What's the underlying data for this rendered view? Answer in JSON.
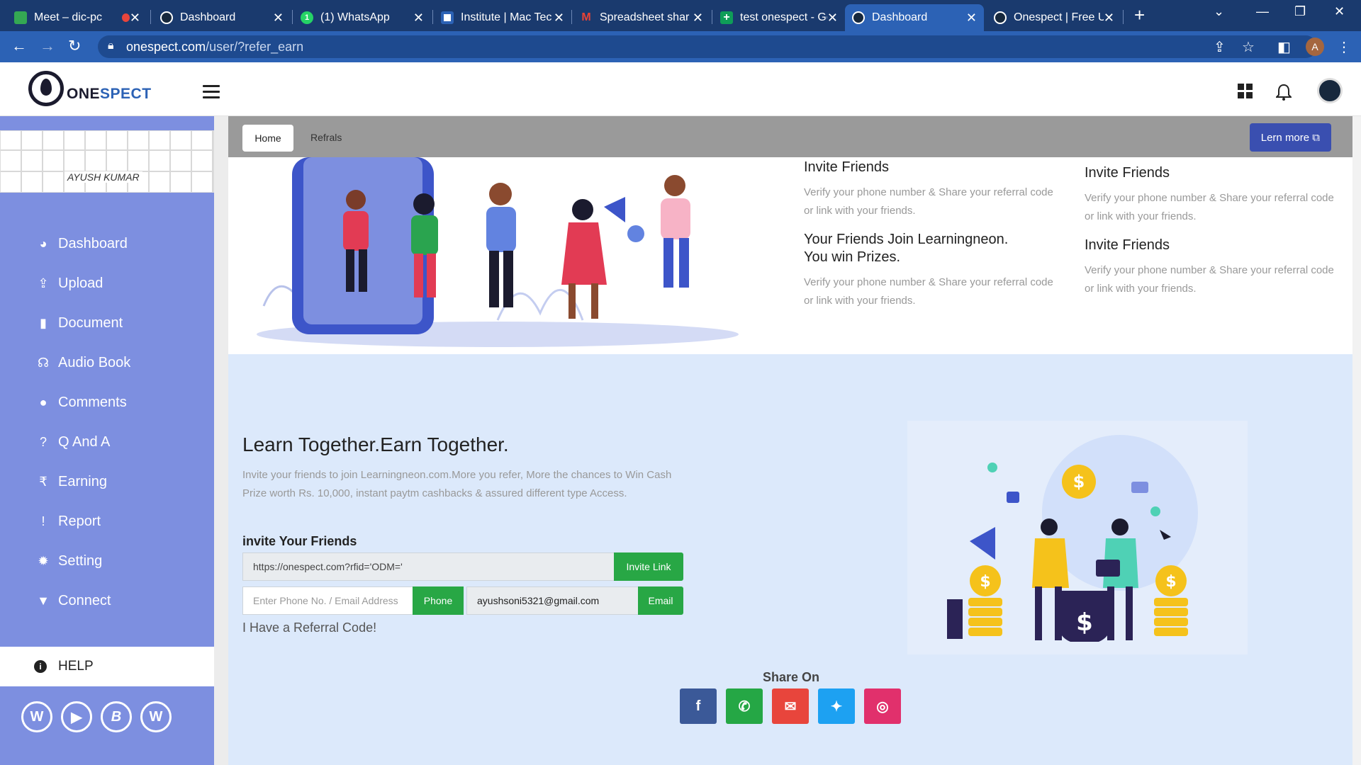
{
  "browser": {
    "tabs": [
      {
        "title": "Meet – dic-pc",
        "fav_color": "#34a853",
        "fav_char": "",
        "active": false
      },
      {
        "title": "Dashboard",
        "fav_color": "#17283d",
        "fav_char": "",
        "active": false
      },
      {
        "title": "(1) WhatsApp",
        "fav_color": "#25d366",
        "fav_char": "1",
        "active": false
      },
      {
        "title": "Institute | Mac Tec",
        "fav_color": "#ffffff",
        "fav_char": "",
        "active": false
      },
      {
        "title": "Spreadsheet shar",
        "fav_color": "#ea4335",
        "fav_char": "M",
        "active": false
      },
      {
        "title": "test onespect - Go",
        "fav_color": "#0f9d58",
        "fav_char": "+",
        "active": false
      },
      {
        "title": "Dashboard",
        "fav_color": "#17283d",
        "fav_char": "",
        "active": true
      },
      {
        "title": "Onespect | Free U",
        "fav_color": "#17283d",
        "fav_char": "",
        "active": false
      }
    ],
    "url_host": "onespect.com",
    "url_path": "/user/?refer_earn",
    "profile_initial": "A"
  },
  "header": {
    "logo_part1": "ONE",
    "logo_part2": "SPECT"
  },
  "sidebar": {
    "user_name": "AYUSH KUMAR",
    "items": [
      {
        "label": "Dashboard",
        "icon": "dashboard-icon",
        "glyph": "◕"
      },
      {
        "label": "Upload",
        "icon": "upload-icon",
        "glyph": "⇪"
      },
      {
        "label": "Document",
        "icon": "document-icon",
        "glyph": "▮"
      },
      {
        "label": "Audio Book",
        "icon": "headphones-icon",
        "glyph": "☊"
      },
      {
        "label": "Comments",
        "icon": "comment-icon",
        "glyph": "●"
      },
      {
        "label": "Q And A",
        "icon": "question-icon",
        "glyph": "?"
      },
      {
        "label": "Earning",
        "icon": "rupee-icon",
        "glyph": "₹"
      },
      {
        "label": "Report",
        "icon": "alert-icon",
        "glyph": "!"
      },
      {
        "label": "Setting",
        "icon": "gear-icon",
        "glyph": "✹"
      },
      {
        "label": "Connect",
        "icon": "filter-icon",
        "glyph": "▼"
      }
    ],
    "help_label": "HELP",
    "social": [
      {
        "name": "wordpress-icon",
        "glyph": "W"
      },
      {
        "name": "youtube-icon",
        "glyph": "▶"
      },
      {
        "name": "blogger-icon",
        "glyph": "B"
      },
      {
        "name": "wordpress-icon",
        "glyph": "W"
      }
    ]
  },
  "topnav": {
    "home": "Home",
    "refrals": "Refrals",
    "lern_more": "Lern more ⧉"
  },
  "info": [
    {
      "title": "Invite Friends",
      "desc": "Verify your phone number & Share your referral code or link with your friends."
    },
    {
      "title": "Your Friends Join Learningneon. You win Prizes.",
      "desc": "Verify your phone number & Share your referral code or link with your friends."
    },
    {
      "title": "Invite Friends",
      "desc": "Verify your phone number & Share your referral code or link with your friends."
    },
    {
      "title": "Invite Friends",
      "desc": "Verify your phone number & Share your referral code or link with your friends."
    }
  ],
  "earn": {
    "title": "Learn Together.Earn Together.",
    "desc": "Invite your friends to join Learningneon.com.More you refer, More the chances to Win Cash Prize worth Rs. 10,000, instant paytm cashbacks & assured different type Access.",
    "invite_label": "invite Your Friends",
    "invite_link_value": "https://onespect.com?rfid='ODM='",
    "invite_link_button": "Invite Link",
    "phone_placeholder": "Enter Phone No. / Email Address",
    "phone_button": "Phone",
    "email_value": "ayushsoni5321@gmail.com",
    "email_button": "Email",
    "referral_code_link": "I Have a Referral Code!",
    "share_label": "Share On",
    "share_buttons": [
      {
        "name": "facebook-icon",
        "glyph": "f",
        "color": "#3b5998"
      },
      {
        "name": "whatsapp-icon",
        "glyph": "✆",
        "color": "#25a745"
      },
      {
        "name": "email-icon",
        "glyph": "✉",
        "color": "#e8453c"
      },
      {
        "name": "twitter-icon",
        "glyph": "✦",
        "color": "#1da1f2"
      },
      {
        "name": "instagram-icon",
        "glyph": "◎",
        "color": "#e1306c"
      }
    ]
  }
}
